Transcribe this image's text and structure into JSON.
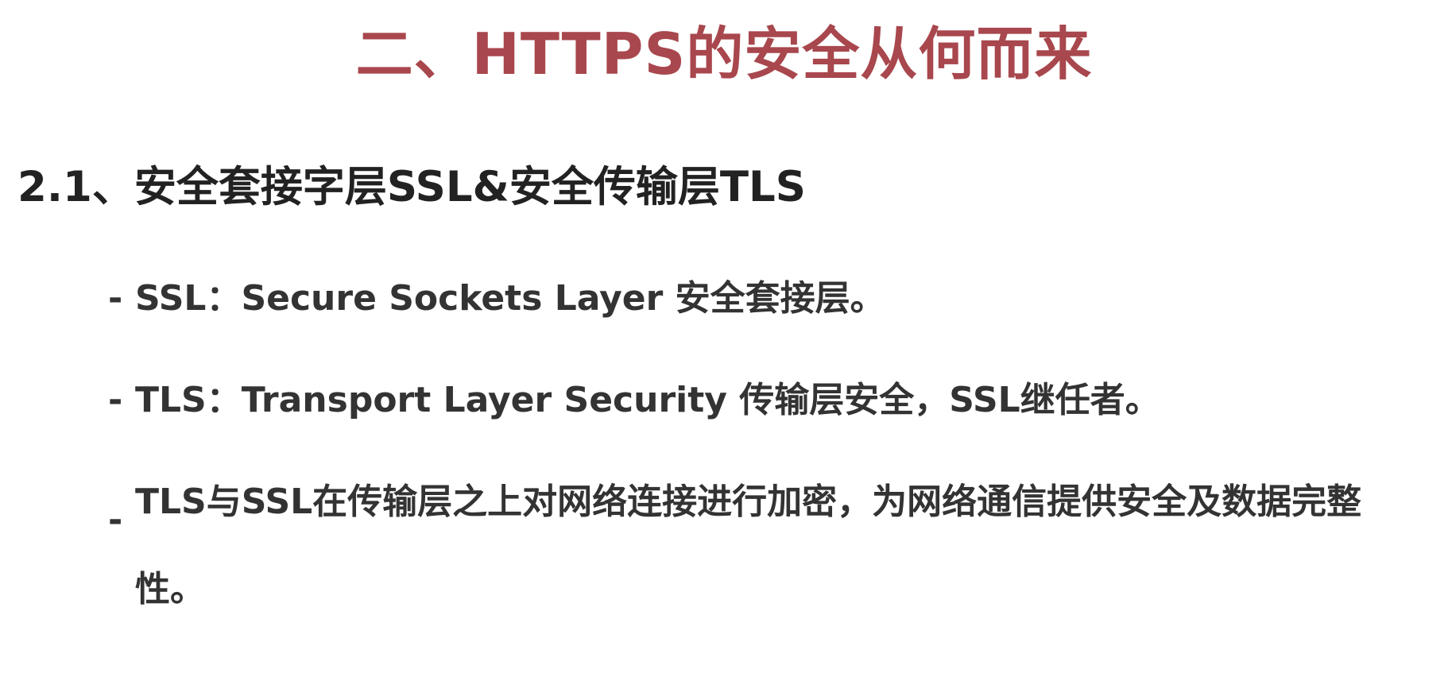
{
  "slide": {
    "title": "二、HTTPS的安全从何而来",
    "section_heading": "2.1、安全套接字层SSL&安全传输层TLS",
    "bullet_marker": "-",
    "bullets": [
      {
        "text": "SSL：Secure Sockets Layer 安全套接层。"
      },
      {
        "text": "TLS：Transport Layer Security 传输层安全，SSL继任者。"
      },
      {
        "text": "TLS与SSL在传输层之上对网络连接进行加密，为网络通信提供安全及数据完整性。"
      }
    ]
  },
  "colors": {
    "title": "#a8474d",
    "heading": "#222222",
    "body": "#333333",
    "background": "#ffffff"
  }
}
